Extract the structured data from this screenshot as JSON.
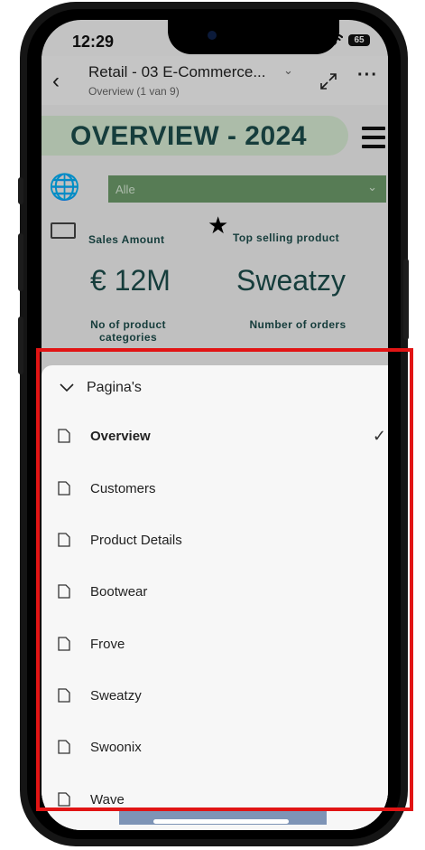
{
  "status_bar": {
    "time": "12:29",
    "battery": "65"
  },
  "header": {
    "title": "Retail - 03 E-Commerce...",
    "subtitle": "Overview (1 van 9)"
  },
  "report": {
    "title": "OVERVIEW - 2024",
    "filter_value": "Alle",
    "kpis": {
      "sales_amount_label": "Sales Amount",
      "sales_amount_value": "€ 12M",
      "top_product_label": "Top selling product",
      "top_product_value": "Sweatzy",
      "categories_label": "No of product categories",
      "orders_label": "Number of orders"
    }
  },
  "pages_sheet": {
    "header": "Pagina's",
    "items": [
      {
        "label": "Overview",
        "selected": true
      },
      {
        "label": "Customers"
      },
      {
        "label": "Product Details"
      },
      {
        "label": "Bootwear"
      },
      {
        "label": "Frove"
      },
      {
        "label": "Sweatzy"
      },
      {
        "label": "Swoonix"
      },
      {
        "label": "Wave"
      }
    ]
  },
  "colors": {
    "accent_dark": "#1c4d4b",
    "pill": "#d7ecd4",
    "filter": "#6d9c6b",
    "highlight": "#e11414"
  }
}
